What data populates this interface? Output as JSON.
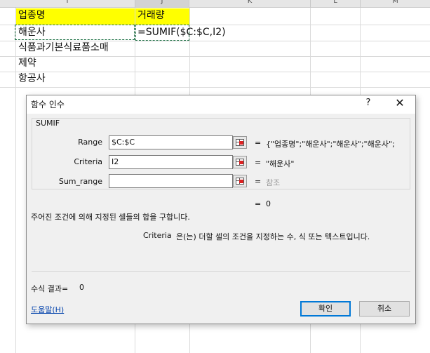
{
  "sheet": {
    "columns": [
      "I",
      "J",
      "K",
      "L",
      "M"
    ],
    "header_row": {
      "col_i": "업종명",
      "col_j": "거래량"
    },
    "rows": [
      "해운사",
      "식품과기본식료품소매",
      "제약",
      "항공사"
    ],
    "formula_cell": "=SUMIF($C:$C,I2)",
    "header_fill_color": "#ffff00"
  },
  "dialog": {
    "title": "함수 인수",
    "help_glyph": "?",
    "close_glyph": "✕",
    "function_name": "SUMIF",
    "args": [
      {
        "label": "Range",
        "value": "$C:$C",
        "result": "{\"업종명\";\"해운사\";\"해운사\";\"해운사\";"
      },
      {
        "label": "Criteria",
        "value": "I2",
        "result": "\"해운사\""
      },
      {
        "label": "Sum_range",
        "value": "",
        "result": "참조"
      }
    ],
    "equals": "=",
    "function_result": "0",
    "description": "주어진 조건에 의해 지정된 셀들의 합을 구합니다.",
    "arg_description_name": "Criteria",
    "arg_description": "은(는) 더할 셀의 조건을 지정하는 수, 식 또는 텍스트입니다.",
    "formula_result_label": "수식 결과=",
    "formula_result_value": "0",
    "help_link": "도움말(H)",
    "ok_label": "확인",
    "cancel_label": "취소"
  }
}
